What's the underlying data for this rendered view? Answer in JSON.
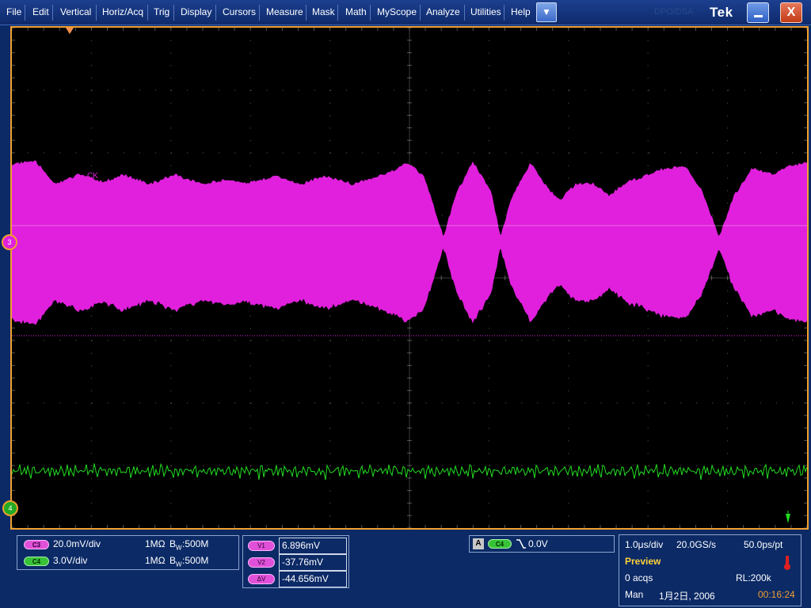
{
  "menu": {
    "items": [
      "File",
      "Edit",
      "Vertical",
      "Horiz/Acq",
      "Trig",
      "Display",
      "Cursors",
      "Measure",
      "Mask",
      "Math",
      "MyScope",
      "Analyze",
      "Utilities",
      "Help"
    ],
    "dropdown_icon": "triangle-down-icon",
    "brand": "Tek",
    "brand_faint": "DPO/DSA",
    "minimize_icon": "minimize-icon",
    "close_label": "X"
  },
  "display": {
    "channel_label": "CK",
    "ch3_marker": "3",
    "ch4_marker": "4",
    "colors": {
      "grid": "#6a6a6a",
      "ch3": "#e020dc",
      "ch4": "#22dd22",
      "frame": "#f0a030",
      "cursor_line": "#e020dc",
      "trigger_marker": "#f09050"
    }
  },
  "channels": {
    "c3": {
      "badge": "C3",
      "scale": "20.0mV/div",
      "impedance": "1MΩ",
      "bw_label": "B",
      "bw_sub": "W",
      "bandwidth": ":500M"
    },
    "c4": {
      "badge": "C4",
      "scale": "3.0V/div",
      "impedance": "1MΩ",
      "bw_label": "B",
      "bw_sub": "W",
      "bandwidth": ":500M"
    }
  },
  "cursors": {
    "v1": {
      "label": "V1",
      "value": "6.896mV"
    },
    "v2": {
      "label": "V2",
      "value": "-37.76mV"
    },
    "dv": {
      "label": "ΔV",
      "value": "-44.656mV"
    }
  },
  "trigger": {
    "mode": "A",
    "source": "C4",
    "slope_icon": "falling-edge-icon",
    "level": "0.0V"
  },
  "acquisition": {
    "timebase": "1.0μs/div",
    "sample_rate": "20.0GS/s",
    "resolution": "50.0ps/pt",
    "status": "Preview",
    "acqs": "0 acqs",
    "record_length": "RL:200k",
    "mode": "Man",
    "date": "1月2日, 2006",
    "time": "00:16:24",
    "thermometer_icon": "thermometer-icon"
  }
}
